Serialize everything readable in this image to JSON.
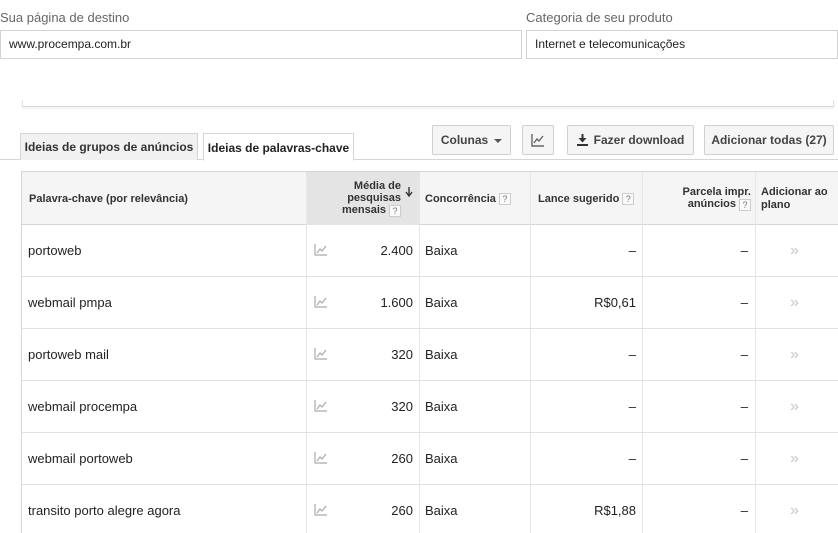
{
  "form": {
    "landing_label": "Sua página de destino",
    "landing_value": "www.procempa.com.br",
    "category_label": "Categoria de seu produto",
    "category_value": "Internet e telecomunicações"
  },
  "tabs": [
    {
      "label": "Ideias de grupos de anúncios",
      "active": false
    },
    {
      "label": "Ideias de palavras-chave",
      "active": true
    }
  ],
  "toolbar": {
    "columns_label": "Colunas",
    "chart_icon": "chart-icon",
    "download_label": "Fazer download",
    "download_icon": "download-icon",
    "add_all_label": "Adicionar todas (27)"
  },
  "table": {
    "headers": {
      "keyword": "Palavra-chave (por relevância)",
      "avg_searches_line1": "Média de",
      "avg_searches_line2": "pesquisas",
      "avg_searches_line3": "mensais",
      "competition": "Concorrência",
      "suggested_bid": "Lance sugerido",
      "impr_share_line1": "Parcela impr.",
      "impr_share_line2": "anúncios",
      "add_to_plan_line1": "Adicionar ao",
      "add_to_plan_line2": "plano",
      "help": "?"
    },
    "rows": [
      {
        "keyword": "portoweb",
        "searches": "2.400",
        "competition": "Baixa",
        "bid": "–",
        "share": "–",
        "add": "»"
      },
      {
        "keyword": "webmail pmpa",
        "searches": "1.600",
        "competition": "Baixa",
        "bid": "R$0,61",
        "share": "–",
        "add": "»"
      },
      {
        "keyword": "portoweb mail",
        "searches": "320",
        "competition": "Baixa",
        "bid": "–",
        "share": "–",
        "add": "»"
      },
      {
        "keyword": "webmail procempa",
        "searches": "320",
        "competition": "Baixa",
        "bid": "–",
        "share": "–",
        "add": "»"
      },
      {
        "keyword": "webmail portoweb",
        "searches": "260",
        "competition": "Baixa",
        "bid": "–",
        "share": "–",
        "add": "»"
      },
      {
        "keyword": "transito porto alegre agora",
        "searches": "260",
        "competition": "Baixa",
        "bid": "R$1,88",
        "share": "–",
        "add": "»"
      }
    ]
  }
}
